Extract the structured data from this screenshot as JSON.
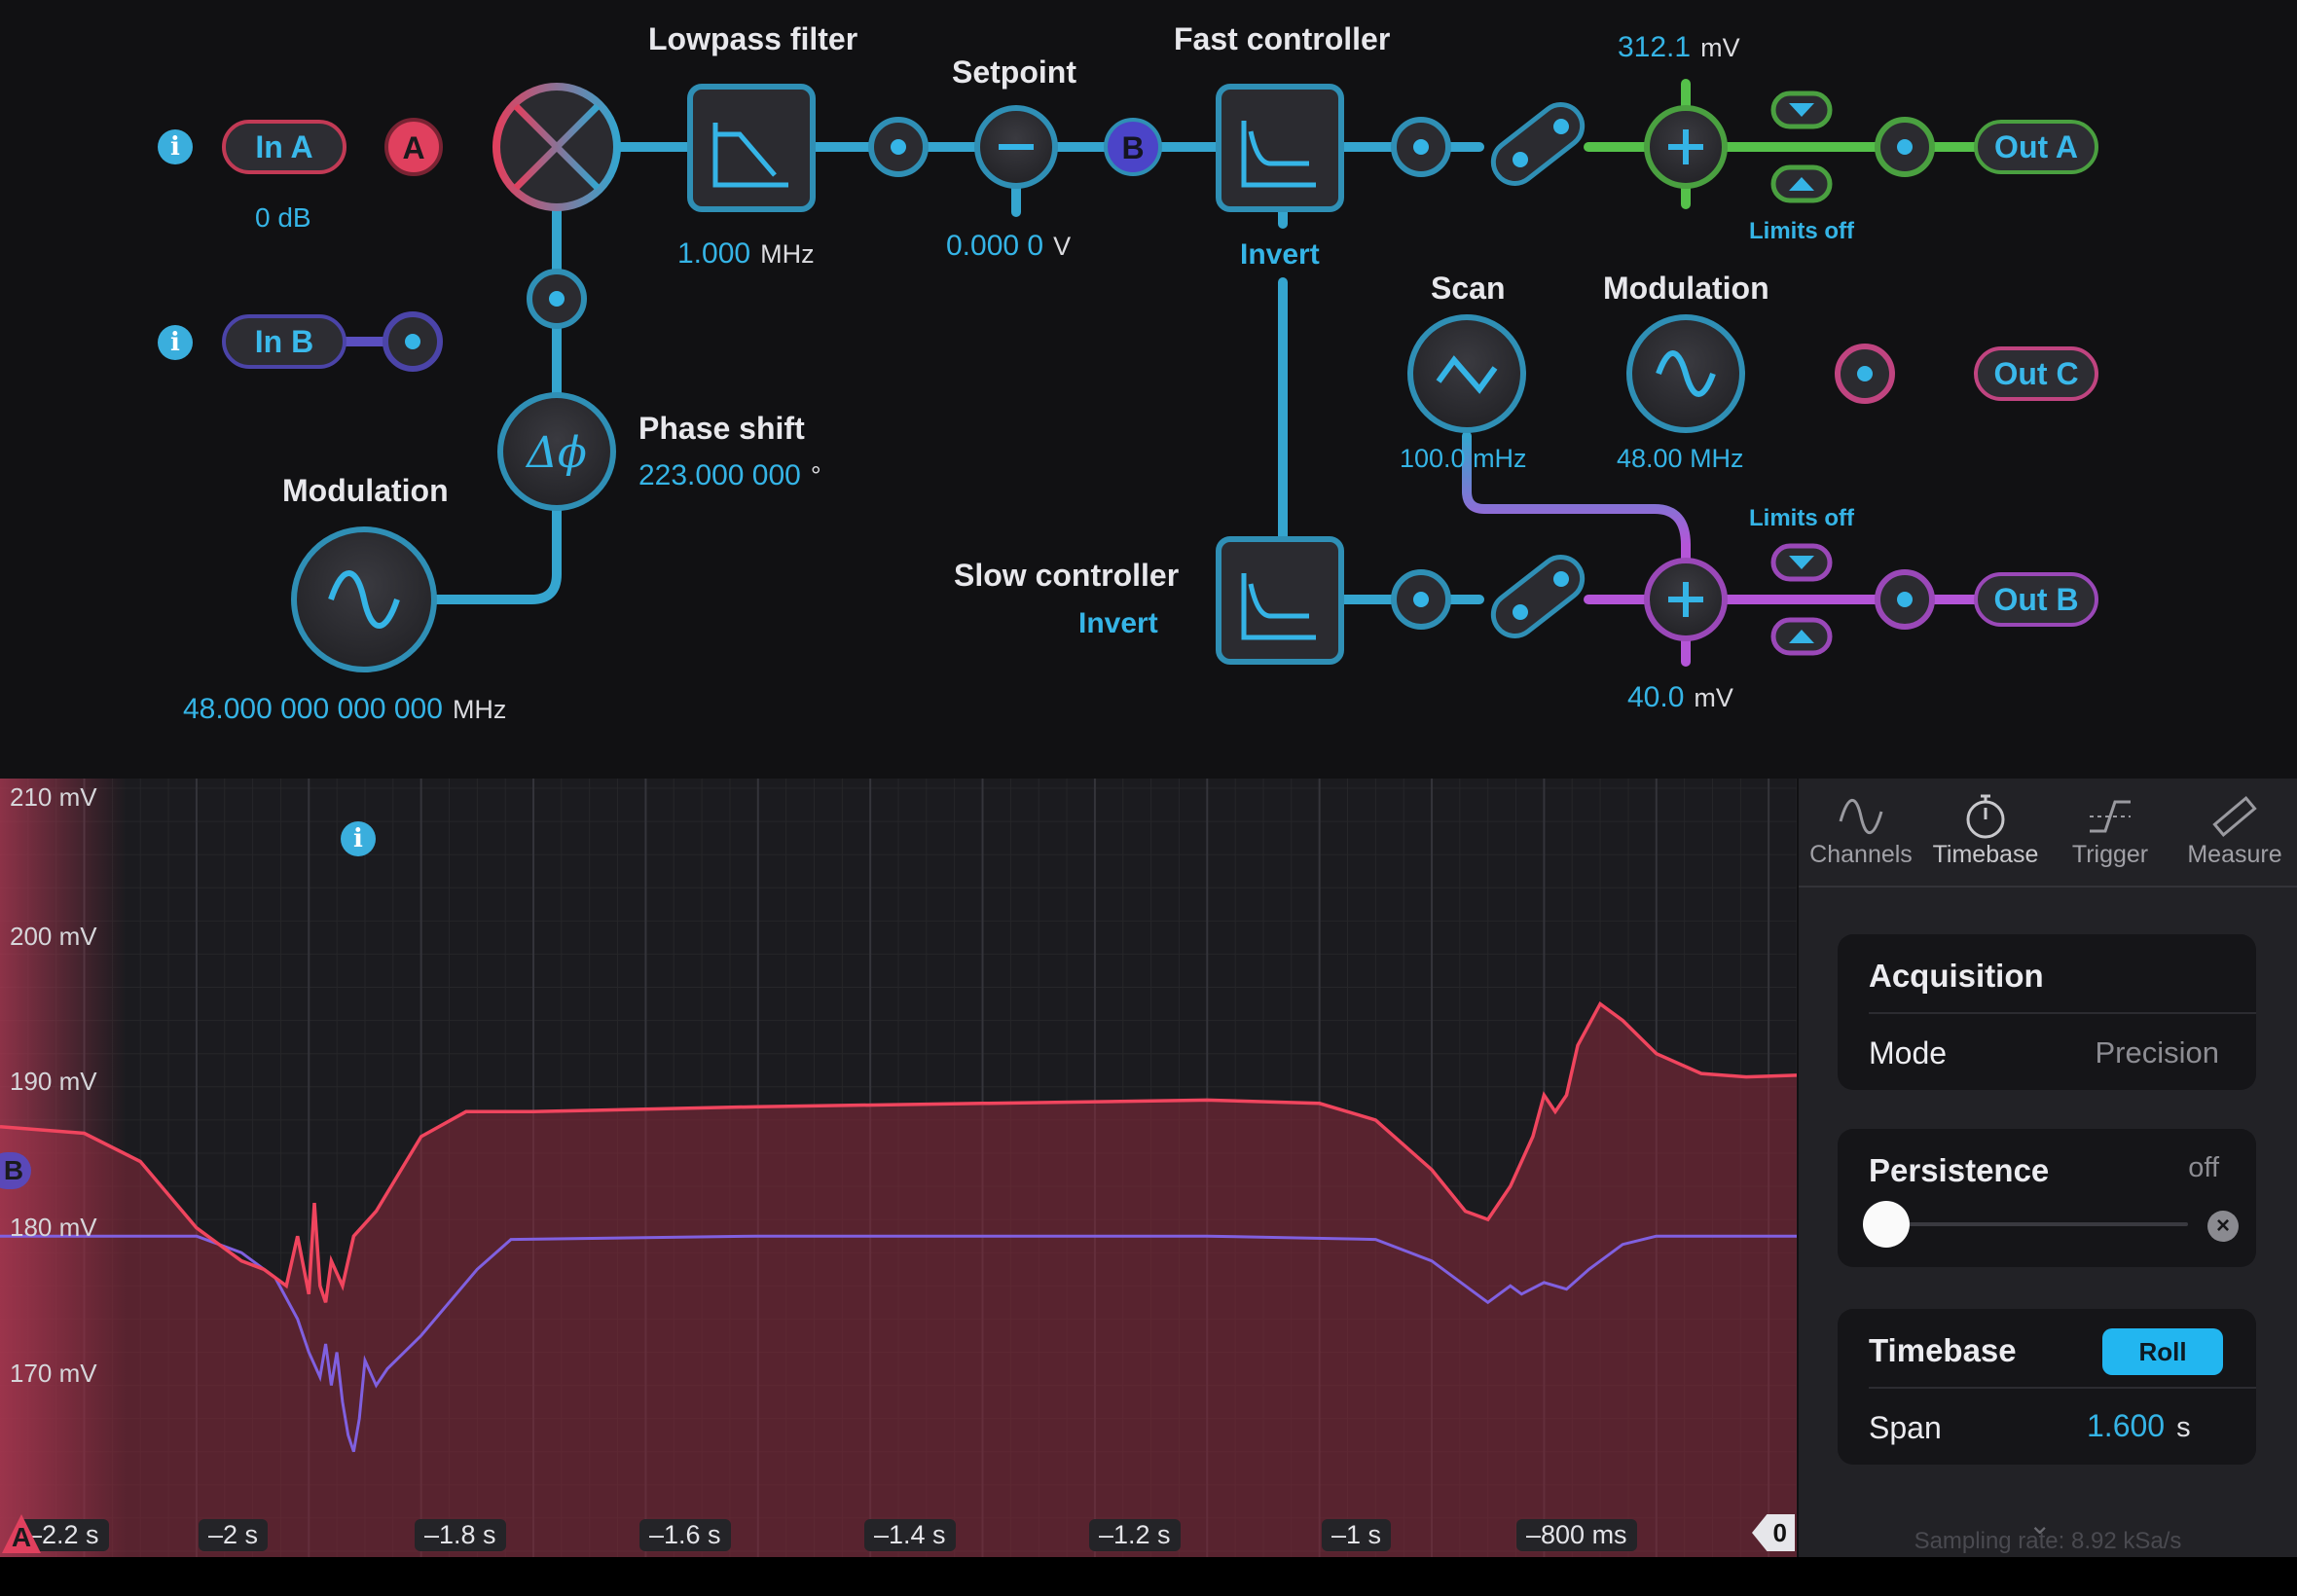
{
  "flow": {
    "in_a": {
      "label": "In A",
      "gain": "0 dB",
      "marker": "A"
    },
    "in_b": {
      "label": "In B"
    },
    "lowpass": {
      "title": "Lowpass filter",
      "value": "1.000",
      "unit": "MHz"
    },
    "setpoint": {
      "title": "Setpoint",
      "value": "0.000 0",
      "unit": "V",
      "marker": "B"
    },
    "fast_controller": {
      "title": "Fast controller",
      "invert": "Invert"
    },
    "slow_controller": {
      "title": "Slow controller",
      "invert": "Invert"
    },
    "phase_shift": {
      "title": "Phase shift",
      "value": "223.000 000",
      "unit": "°",
      "symbol": "Δϕ"
    },
    "modulation_left": {
      "title": "Modulation",
      "value": "48.000 000 000 000",
      "unit": "MHz"
    },
    "offset_a": {
      "value": "312.1",
      "unit": "mV",
      "limits": "Limits off"
    },
    "offset_b": {
      "value": "40.0",
      "unit": "mV",
      "limits": "Limits off"
    },
    "scan": {
      "title": "Scan",
      "value": "100.0 mHz"
    },
    "modulation_right": {
      "title": "Modulation",
      "value": "48.00 MHz"
    },
    "out_a": "Out A",
    "out_b": "Out B",
    "out_c": "Out C"
  },
  "scope": {
    "y_labels": [
      "210 mV",
      "200 mV",
      "190 mV",
      "180 mV",
      "170 mV"
    ],
    "x_labels": [
      "–2.2 s",
      "–2 s",
      "–1.8 s",
      "–1.6 s",
      "–1.4 s",
      "–1.2 s",
      "–1 s",
      "–800 ms"
    ],
    "channel_a_marker": "A",
    "channel_b_marker": "B",
    "trigger_marker": "0",
    "colors": {
      "channel_a": "#f0455e",
      "channel_b": "#8060e0"
    }
  },
  "chart_data": {
    "type": "line",
    "xlabel": "",
    "ylabel": "",
    "x_unit": "s",
    "y_unit": "mV",
    "xlim": [
      -2.275,
      -0.675
    ],
    "ylim": [
      165,
      211
    ],
    "grid": true,
    "series": [
      {
        "name": "A",
        "color": "#f0455e",
        "points": [
          [
            -2.275,
            190.6
          ],
          [
            -2.2,
            190.2
          ],
          [
            -2.15,
            188.5
          ],
          [
            -2.1,
            184.5
          ],
          [
            -2.06,
            182.5
          ],
          [
            -2.04,
            182.0
          ],
          [
            -2.02,
            181.0
          ],
          [
            -2.01,
            184.0
          ],
          [
            -2.0,
            180.5
          ],
          [
            -1.995,
            186.0
          ],
          [
            -1.99,
            181.0
          ],
          [
            -1.985,
            180.0
          ],
          [
            -1.98,
            182.5
          ],
          [
            -1.97,
            181.0
          ],
          [
            -1.96,
            184.0
          ],
          [
            -1.94,
            185.5
          ],
          [
            -1.9,
            190.0
          ],
          [
            -1.86,
            191.5
          ],
          [
            -1.8,
            191.5
          ],
          [
            -1.6,
            191.8
          ],
          [
            -1.4,
            192.0
          ],
          [
            -1.2,
            192.2
          ],
          [
            -1.1,
            192.0
          ],
          [
            -1.05,
            191.0
          ],
          [
            -1.0,
            188.0
          ],
          [
            -0.97,
            185.5
          ],
          [
            -0.95,
            185.0
          ],
          [
            -0.93,
            187.0
          ],
          [
            -0.91,
            190.0
          ],
          [
            -0.9,
            192.5
          ],
          [
            -0.89,
            191.5
          ],
          [
            -0.88,
            192.5
          ],
          [
            -0.87,
            195.5
          ],
          [
            -0.85,
            198.0
          ],
          [
            -0.83,
            197.0
          ],
          [
            -0.8,
            195.0
          ],
          [
            -0.76,
            193.8
          ],
          [
            -0.72,
            193.6
          ],
          [
            -0.675,
            193.7
          ]
        ]
      },
      {
        "name": "B",
        "color": "#8060e0",
        "points": [
          [
            -2.275,
            184.0
          ],
          [
            -2.1,
            184.0
          ],
          [
            -2.06,
            183.0
          ],
          [
            -2.03,
            181.5
          ],
          [
            -2.01,
            179.0
          ],
          [
            -2.0,
            177.0
          ],
          [
            -1.99,
            175.5
          ],
          [
            -1.985,
            177.5
          ],
          [
            -1.98,
            175.0
          ],
          [
            -1.975,
            177.0
          ],
          [
            -1.97,
            174.0
          ],
          [
            -1.965,
            172.0
          ],
          [
            -1.96,
            171.0
          ],
          [
            -1.955,
            173.0
          ],
          [
            -1.95,
            176.5
          ],
          [
            -1.94,
            175.0
          ],
          [
            -1.93,
            176.0
          ],
          [
            -1.9,
            178.0
          ],
          [
            -1.85,
            182.0
          ],
          [
            -1.82,
            183.8
          ],
          [
            -1.6,
            184.0
          ],
          [
            -1.4,
            184.0
          ],
          [
            -1.2,
            184.0
          ],
          [
            -1.05,
            183.8
          ],
          [
            -1.0,
            182.5
          ],
          [
            -0.97,
            181.0
          ],
          [
            -0.95,
            180.0
          ],
          [
            -0.93,
            181.0
          ],
          [
            -0.92,
            180.5
          ],
          [
            -0.9,
            181.2
          ],
          [
            -0.88,
            180.8
          ],
          [
            -0.86,
            182.0
          ],
          [
            -0.83,
            183.5
          ],
          [
            -0.8,
            184.0
          ],
          [
            -0.675,
            184.0
          ]
        ]
      }
    ]
  },
  "panel": {
    "tabs": [
      "Channels",
      "Timebase",
      "Trigger",
      "Measure"
    ],
    "acquisition": {
      "title": "Acquisition",
      "mode_label": "Mode",
      "mode_value": "Precision"
    },
    "persistence": {
      "title": "Persistence",
      "value": "off",
      "level": 0
    },
    "timebase": {
      "title": "Timebase",
      "roll": "Roll",
      "span_label": "Span",
      "span_value": "1.600",
      "span_unit": "s"
    },
    "sampling": "Sampling rate: 8.92 kSa/s"
  }
}
